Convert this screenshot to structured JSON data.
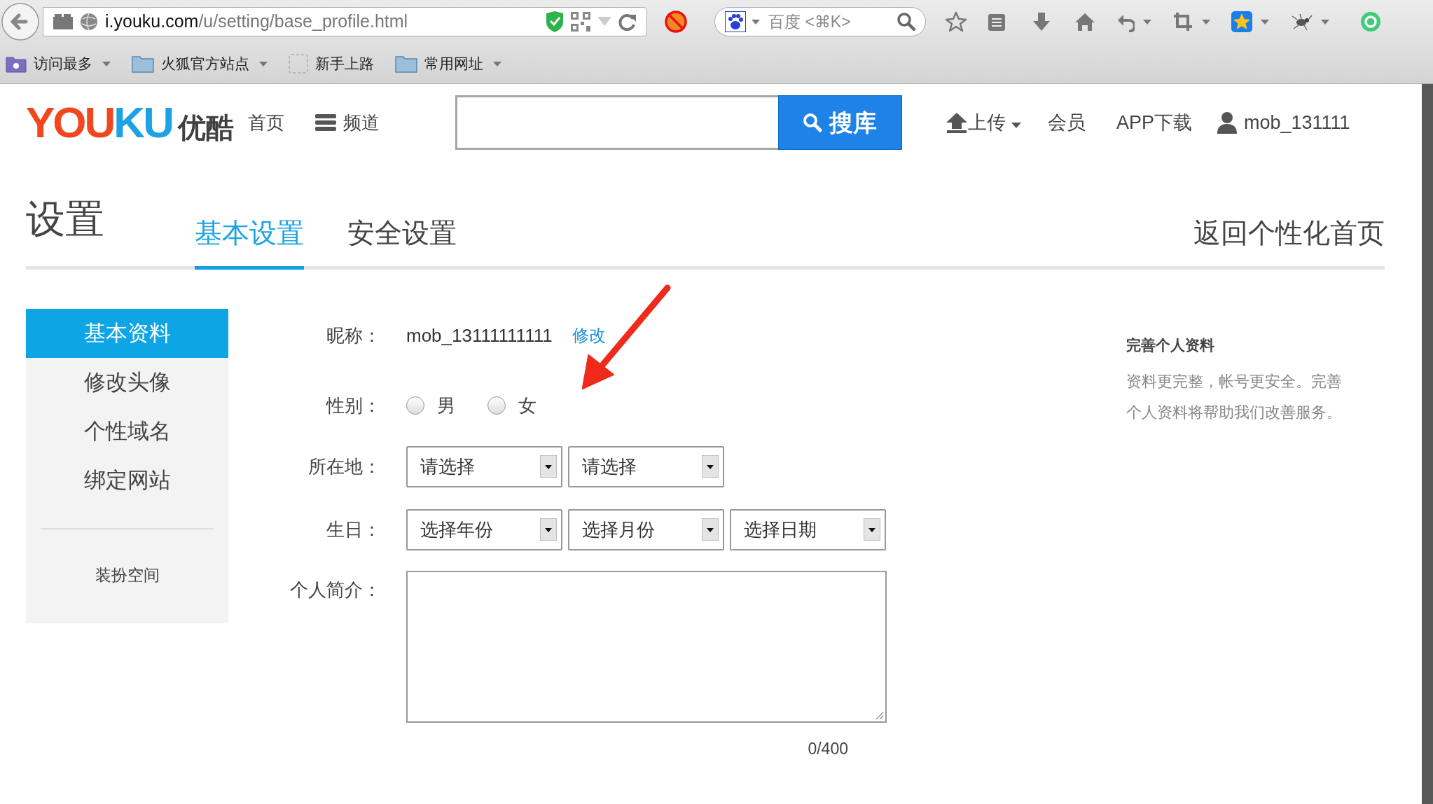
{
  "browser": {
    "url_host": "i.youku.com",
    "url_path": "/u/setting/base_profile.html",
    "search_placeholder": "百度 <⌘K>",
    "bookmarks": [
      {
        "label": "访问最多",
        "kind": "smart",
        "dropdown": true
      },
      {
        "label": "火狐官方站点",
        "kind": "folder",
        "dropdown": true
      },
      {
        "label": "新手上路",
        "kind": "page",
        "dropdown": false
      },
      {
        "label": "常用网址",
        "kind": "folder",
        "dropdown": true
      }
    ]
  },
  "header": {
    "logo": [
      {
        "text": "YOU",
        "color": "#f0471e"
      },
      {
        "text": "KU",
        "color": "#1ba3e4"
      },
      {
        "text": "优酷",
        "color": "#404040"
      }
    ],
    "nav": [
      {
        "label": "首页",
        "kind": "plain"
      },
      {
        "label": "频道",
        "kind": "menu"
      }
    ],
    "search_button": "搜库",
    "right_nav": [
      {
        "label": "上传",
        "kind": "upload"
      },
      {
        "label": "会员",
        "kind": "plain"
      },
      {
        "label": "APP下载",
        "kind": "plain"
      },
      {
        "label": "mob_131111",
        "kind": "user"
      }
    ]
  },
  "page_title": "设置",
  "tabs": [
    {
      "label": "基本设置",
      "selected": true
    },
    {
      "label": "安全设置",
      "selected": false
    }
  ],
  "back_link": "返回个性化首页",
  "sidebar": {
    "items": [
      {
        "label": "基本资料",
        "selected": true
      },
      {
        "label": "修改头像",
        "selected": false
      },
      {
        "label": "个性域名",
        "selected": false
      },
      {
        "label": "绑定网站",
        "selected": false
      }
    ],
    "extra": "装扮空间"
  },
  "form": {
    "nickname": {
      "label": "昵称：",
      "value": "mob_13111111111",
      "action": "修改"
    },
    "gender": {
      "label": "性别：",
      "options": [
        {
          "label": "男",
          "selected": false
        },
        {
          "label": "女",
          "selected": false
        }
      ]
    },
    "location": {
      "label": "所在地：",
      "selects": [
        "请选择",
        "请选择"
      ]
    },
    "birthday": {
      "label": "生日：",
      "selects": [
        "选择年份",
        "选择月份",
        "选择日期"
      ]
    },
    "bio": {
      "label": "个人简介：",
      "counter": "0/400"
    }
  },
  "info": {
    "title": "完善个人资料",
    "body": "资料更完整，帐号更安全。完善个人资料将帮助我们改善服务。"
  }
}
